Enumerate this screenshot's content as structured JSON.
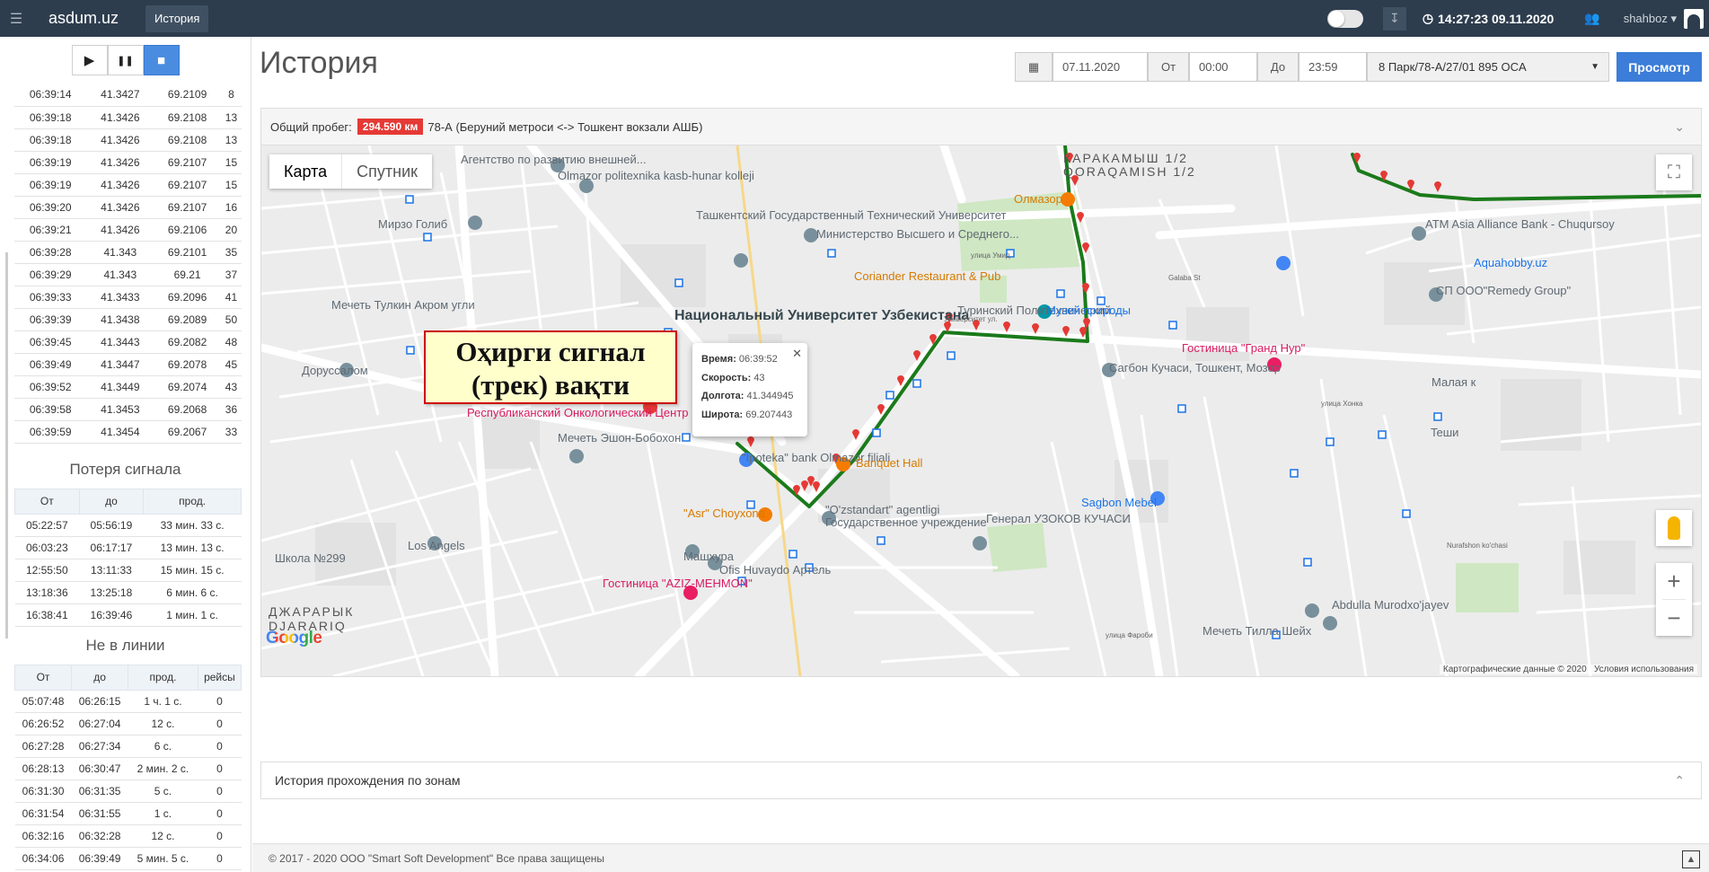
{
  "topbar": {
    "brand": "asdum.uz",
    "nav_history": "История",
    "clock": "14:27:23 09.11.2020",
    "username": "shahboz"
  },
  "player": {
    "play": "▶",
    "pause": "❚❚",
    "stop": "■"
  },
  "track_rows": [
    [
      "06:39:14",
      "41.3427",
      "69.2109",
      "8"
    ],
    [
      "06:39:18",
      "41.3426",
      "69.2108",
      "13"
    ],
    [
      "06:39:18",
      "41.3426",
      "69.2108",
      "13"
    ],
    [
      "06:39:19",
      "41.3426",
      "69.2107",
      "15"
    ],
    [
      "06:39:19",
      "41.3426",
      "69.2107",
      "15"
    ],
    [
      "06:39:20",
      "41.3426",
      "69.2107",
      "16"
    ],
    [
      "06:39:21",
      "41.3426",
      "69.2106",
      "20"
    ],
    [
      "06:39:28",
      "41.343",
      "69.2101",
      "35"
    ],
    [
      "06:39:29",
      "41.343",
      "69.21",
      "37"
    ],
    [
      "06:39:33",
      "41.3433",
      "69.2096",
      "41"
    ],
    [
      "06:39:39",
      "41.3438",
      "69.2089",
      "50"
    ],
    [
      "06:39:45",
      "41.3443",
      "69.2082",
      "48"
    ],
    [
      "06:39:49",
      "41.3447",
      "69.2078",
      "45"
    ],
    [
      "06:39:52",
      "41.3449",
      "69.2074",
      "43"
    ],
    [
      "06:39:58",
      "41.3453",
      "69.2068",
      "36"
    ],
    [
      "06:39:59",
      "41.3454",
      "69.2067",
      "33"
    ]
  ],
  "signal_loss": {
    "title": "Потеря сигнала",
    "headers": [
      "От",
      "до",
      "прод."
    ],
    "rows": [
      [
        "05:22:57",
        "05:56:19",
        "33 мин. 33 с."
      ],
      [
        "06:03:23",
        "06:17:17",
        "13 мин. 13 с."
      ],
      [
        "12:55:50",
        "13:11:33",
        "15 мин. 15 с."
      ],
      [
        "13:18:36",
        "13:25:18",
        "6 мин. 6 с."
      ],
      [
        "16:38:41",
        "16:39:46",
        "1 мин. 1 с."
      ]
    ]
  },
  "offline": {
    "title": "Не в линии",
    "headers": [
      "От",
      "до",
      "прод.",
      "рейсы"
    ],
    "rows": [
      [
        "05:07:48",
        "06:26:15",
        "1 ч. 1 с.",
        "0"
      ],
      [
        "06:26:52",
        "06:27:04",
        "12 с.",
        "0"
      ],
      [
        "06:27:28",
        "06:27:34",
        "6 с.",
        "0"
      ],
      [
        "06:28:13",
        "06:30:47",
        "2 мин. 2 с.",
        "0"
      ],
      [
        "06:31:30",
        "06:31:35",
        "5 с.",
        "0"
      ],
      [
        "06:31:54",
        "06:31:55",
        "1 с.",
        "0"
      ],
      [
        "06:32:16",
        "06:32:28",
        "12 с.",
        "0"
      ],
      [
        "06:34:06",
        "06:39:49",
        "5 мин. 5 с.",
        "0"
      ]
    ]
  },
  "page": {
    "title": "История"
  },
  "filters": {
    "date": "07.11.2020",
    "from_label": "От",
    "from_time": "00:00",
    "to_label": "До",
    "to_time": "23:59",
    "vehicle": "8 Парк/78-А/27/01 895 OCA",
    "view_button": "Просмотр"
  },
  "summary": {
    "label": "Общий пробег:",
    "distance": "294.590 км",
    "route": "78-А (Беруний метроси <-> Тошкент вокзали АШБ)"
  },
  "map": {
    "tab_map": "Карта",
    "tab_satellite": "Спутник",
    "attribution": "Картографические данные © 2020",
    "terms": "Условия использования",
    "google": "Google",
    "labels": [
      "Агентство по развитию внешней...",
      "Olmazor politexnika kasb-hunar kolleji",
      "Мирзо Голиб",
      "Ташкентский Государственный Технический Университет",
      "Министерство Высшего и Среднего...",
      "Олмазор",
      "КАРАКАМЫШ 1/2",
      "QORAQAMISH 1/2",
      "ATM Asia Alliance Bank - Chuqursoy",
      "Aquahobby.uz",
      "Coriander Restaurant & Pub",
      "Мечеть Тулкин Акром угли",
      "Национальный Университет Узбекистана",
      "Туринский Политехнический...",
      "Музей природы",
      "СП ООО\"Remedy Group\"",
      "Доруссалом",
      "Гостиница \"Гранд Нур\"",
      "Сагбон Кучаси, Тошкент, Мозор",
      "Республиканский Онкологический Центр",
      "Мечеть Эшон-Бобохон",
      "\"Ipoteka\" bank Olmazor filiali",
      "Banquet Hall",
      "\"Asr\" Choyxona",
      "\"O'zstandart\" agentligi",
      "Государственное учреждение",
      "Генерал УЗОКОВ КУЧАСИ",
      "Sagbon Mebel",
      "Los Angels",
      "Машхура",
      "Ofis Huvaydo Артель",
      "Гостиница \"AZIZ-MEHMON\"",
      "Школа №299",
      "ДЖАРАРЫК",
      "DJARARIQ",
      "Abdulla Murodxo'jayev",
      "Мечеть Тилла Шейх",
      "Teши",
      "Малая к"
    ]
  },
  "infowindow": {
    "time_label": "Время:",
    "time": "06:39:52",
    "speed_label": "Скорость:",
    "speed": "43",
    "lon_label": "Долгота:",
    "lon": "41.344945",
    "lat_label": "Широта:",
    "lat": "69.207443"
  },
  "callout": {
    "line1": "Оҳирги сигнал",
    "line2": "(трек) вақти"
  },
  "zones": {
    "title": "История прохождения по зонам"
  },
  "footer": {
    "text": "© 2017 - 2020 ООО \"Smart Soft Development\" Все права защищены"
  },
  "colors": {
    "topbar": "#2d3d4e",
    "accent": "#3b7dd8",
    "track": "#1b7a1b",
    "marker": "#e53935",
    "badge": "#e53935"
  }
}
